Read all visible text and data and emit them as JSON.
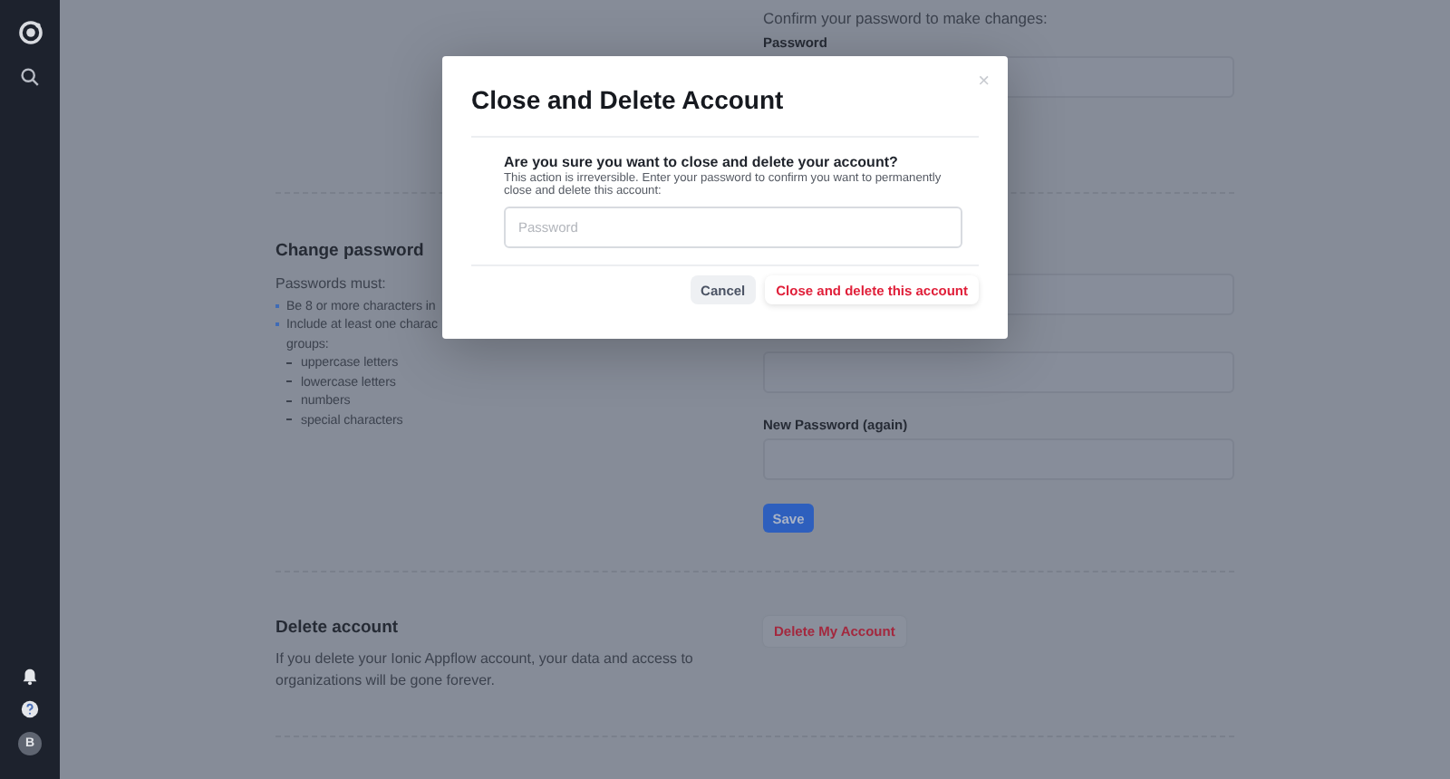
{
  "sidebar": {
    "avatar": "B"
  },
  "confirm_section": {
    "intro": "Confirm your password to make changes:",
    "field_label": "Password"
  },
  "change_password": {
    "title": "Change password",
    "rules_intro": "Passwords must:",
    "rules": [
      {
        "text": "Be 8 or more characters in"
      },
      {
        "text": "Include at least one charac",
        "continuation": "groups:",
        "children": [
          {
            "text": "uppercase letters"
          },
          {
            "text": "lowercase letters"
          },
          {
            "text": "numbers"
          },
          {
            "text": "special characters"
          }
        ]
      }
    ],
    "new_password_again_label": "New Password (again)",
    "save_button": "Save"
  },
  "delete_account": {
    "title": "Delete account",
    "text": "If you delete your Ionic Appflow account, your data and access to organizations will be gone forever.",
    "button": "Delete My Account"
  },
  "modal": {
    "title": "Close and Delete Account",
    "close": "×",
    "question": "Are you sure you want to close and delete your account?",
    "explanation": "This action is irreversible. Enter your password to confirm you want to permanently close and delete this account:",
    "password_placeholder": "Password",
    "buttons": [
      {
        "label": "Cancel",
        "kind": "secondary"
      },
      {
        "label": "Close and delete this account",
        "kind": "danger"
      }
    ]
  }
}
